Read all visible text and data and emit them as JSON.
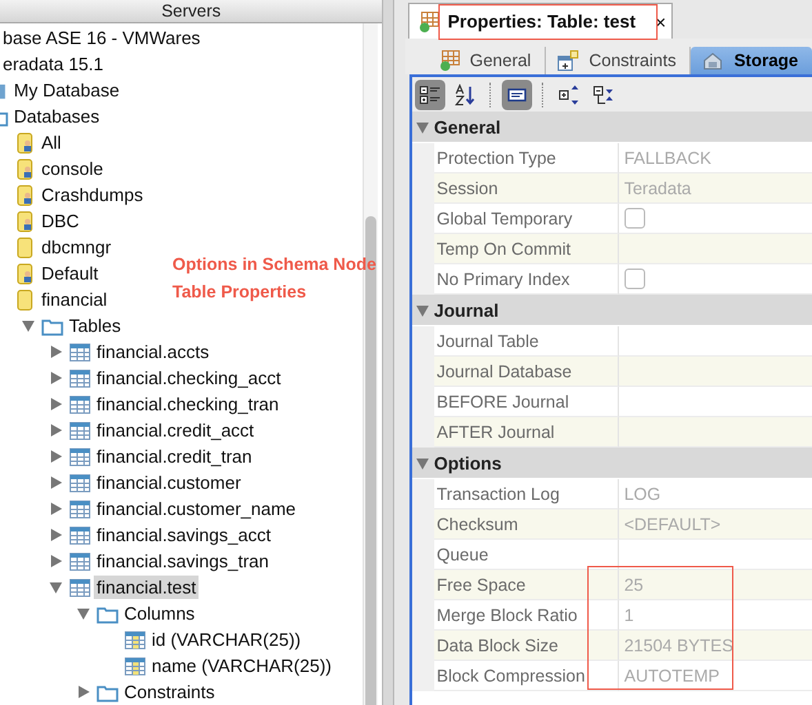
{
  "servers_panel": {
    "title": "Servers",
    "tree": [
      {
        "label": "base ASE 16 - VMWares",
        "selected": false
      },
      {
        "label": "eradata 15.1",
        "selected": false,
        "children": [
          {
            "label": "My Database",
            "kind": "db-node",
            "selected": false
          },
          {
            "label": "Databases",
            "kind": "folder",
            "selected": false,
            "children": [
              {
                "label": "All",
                "kind": "db-user",
                "selected": false
              },
              {
                "label": "console",
                "kind": "db-user",
                "selected": false
              },
              {
                "label": "Crashdumps",
                "kind": "db-user",
                "selected": false
              },
              {
                "label": "DBC",
                "kind": "db-user",
                "selected": false
              },
              {
                "label": "dbcmngr",
                "kind": "db",
                "selected": false
              },
              {
                "label": "Default",
                "kind": "db-user",
                "selected": false
              },
              {
                "label": "financial",
                "kind": "db",
                "selected": false,
                "children": [
                  {
                    "label": "Tables",
                    "kind": "folder",
                    "expanded": true,
                    "selected": false,
                    "children": [
                      {
                        "label": "financial.accts",
                        "kind": "table",
                        "expanded": false,
                        "selected": false
                      },
                      {
                        "label": "financial.checking_acct",
                        "kind": "table",
                        "expanded": false,
                        "selected": false
                      },
                      {
                        "label": "financial.checking_tran",
                        "kind": "table",
                        "expanded": false,
                        "selected": false
                      },
                      {
                        "label": "financial.credit_acct",
                        "kind": "table",
                        "expanded": false,
                        "selected": false
                      },
                      {
                        "label": "financial.credit_tran",
                        "kind": "table",
                        "expanded": false,
                        "selected": false
                      },
                      {
                        "label": "financial.customer",
                        "kind": "table",
                        "expanded": false,
                        "selected": false
                      },
                      {
                        "label": "financial.customer_name",
                        "kind": "table",
                        "expanded": false,
                        "selected": false
                      },
                      {
                        "label": "financial.savings_acct",
                        "kind": "table",
                        "expanded": false,
                        "selected": false
                      },
                      {
                        "label": "financial.savings_tran",
                        "kind": "table",
                        "expanded": false,
                        "selected": false
                      },
                      {
                        "label": "financial.test",
                        "kind": "table",
                        "expanded": true,
                        "selected": true,
                        "children": [
                          {
                            "label": "Columns",
                            "kind": "folder",
                            "expanded": true,
                            "selected": false,
                            "children": [
                              {
                                "label": "id (VARCHAR(25))",
                                "kind": "column",
                                "selected": false
                              },
                              {
                                "label": "name (VARCHAR(25))",
                                "kind": "column",
                                "selected": false
                              }
                            ]
                          },
                          {
                            "label": "Constraints",
                            "kind": "folder",
                            "expanded": false,
                            "selected": false
                          }
                        ]
                      }
                    ]
                  }
                ]
              }
            ]
          }
        ]
      }
    ]
  },
  "annotation": {
    "lines": [
      "Options in Schema Node",
      "Table Properties"
    ]
  },
  "properties_view": {
    "title": "Properties: Table: test",
    "close": "×",
    "tabs": [
      {
        "label": "General",
        "kind": "grid",
        "selected": false
      },
      {
        "label": "Constraints",
        "kind": "constraints",
        "selected": false
      },
      {
        "label": "Storage",
        "kind": "storage",
        "selected": true
      }
    ],
    "toolbar": [
      {
        "kind": "categories",
        "selected": true
      },
      {
        "kind": "sort",
        "selected": false
      },
      {
        "kind": "separator"
      },
      {
        "kind": "description",
        "selected": true
      },
      {
        "kind": "separator"
      },
      {
        "kind": "expand",
        "selected": false
      },
      {
        "kind": "collapse",
        "selected": false
      }
    ],
    "sections": [
      {
        "title": "General",
        "expanded": true,
        "rows": [
          {
            "name": "Protection Type",
            "kind": "text",
            "value": "FALLBACK"
          },
          {
            "name": "Session",
            "kind": "text",
            "value": "Teradata"
          },
          {
            "name": "Global Temporary",
            "kind": "checkbox",
            "checked": false
          },
          {
            "name": "Temp On Commit",
            "kind": "text"
          },
          {
            "name": "No Primary Index",
            "kind": "checkbox",
            "checked": false
          }
        ]
      },
      {
        "title": "Journal",
        "expanded": true,
        "rows": [
          {
            "name": "Journal Table",
            "kind": "text"
          },
          {
            "name": "Journal Database",
            "kind": "text"
          },
          {
            "name": "BEFORE Journal",
            "kind": "text"
          },
          {
            "name": "AFTER Journal",
            "kind": "text"
          }
        ]
      },
      {
        "title": "Options",
        "expanded": true,
        "rows": [
          {
            "name": "Transaction Log",
            "kind": "text",
            "value": "LOG"
          },
          {
            "name": "Checksum",
            "kind": "text",
            "value": "<DEFAULT>"
          },
          {
            "name": "Queue",
            "kind": "text"
          },
          {
            "name": "Free Space",
            "kind": "text",
            "value": "25",
            "highlighted": true
          },
          {
            "name": "Merge Block Ratio",
            "kind": "text",
            "value": "1",
            "highlighted": true
          },
          {
            "name": "Data Block Size",
            "kind": "text",
            "value": "21504 BYTES",
            "highlighted": true
          },
          {
            "name": "Block Compression",
            "kind": "text",
            "value": "AUTOTEMP",
            "highlighted": true
          }
        ]
      }
    ]
  }
}
